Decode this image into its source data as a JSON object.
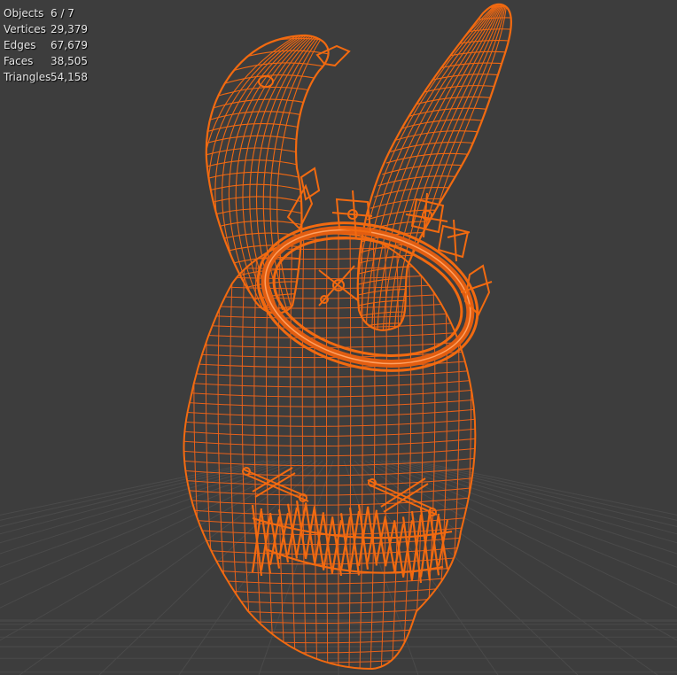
{
  "viewport": {
    "background": "#3d3d3d",
    "grid_color": "#4a4a4a",
    "wire_color": "#f26a10",
    "wire_color_light": "#ff8a30",
    "shading": "wireframe",
    "selected_object": "mask-with-horns-and-crown"
  },
  "statistics": {
    "objects": {
      "label": "Objects",
      "value": "6 / 7"
    },
    "vertices": {
      "label": "Vertices",
      "value": "29,379"
    },
    "edges": {
      "label": "Edges",
      "value": "67,679"
    },
    "faces": {
      "label": "Faces",
      "value": "38,505"
    },
    "triangles": {
      "label": "Triangles",
      "value": "54,158"
    }
  }
}
